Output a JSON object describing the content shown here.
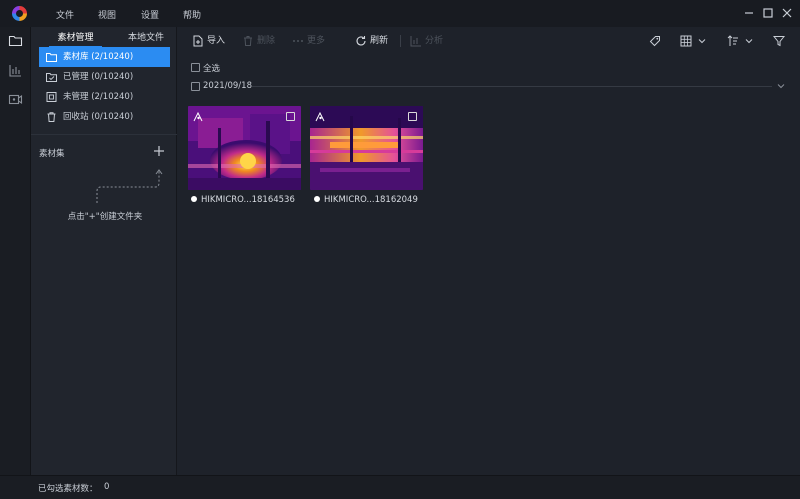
{
  "menu": {
    "items": [
      "文件",
      "视图",
      "设置",
      "帮助"
    ]
  },
  "activity": {
    "icons": [
      "folder-icon",
      "chart-icon",
      "video-icon"
    ]
  },
  "sidebar": {
    "tabs": [
      "素材管理",
      "本地文件"
    ],
    "libraries": [
      {
        "label": "素材库 (2/10240)",
        "icon": "folder-icon",
        "selected": true
      },
      {
        "label": "已管理 (0/10240)",
        "icon": "managed-folder-icon",
        "selected": false
      },
      {
        "label": "未管理 (2/10240)",
        "icon": "unmanaged-icon",
        "selected": false
      },
      {
        "label": "回收站 (0/10240)",
        "icon": "trash-icon",
        "selected": false
      }
    ],
    "sets_title": "素材集",
    "hint": "点击\"+\"创建文件夹"
  },
  "toolbar": {
    "import": "导入",
    "delete": "删除",
    "more": "更多",
    "refresh": "刷新",
    "analyze": "分析"
  },
  "content": {
    "select_all": "全选",
    "date_group": "2021/09/18",
    "items": [
      {
        "name": "HIKMICRO...18164536"
      },
      {
        "name": "HIKMICRO...18162049"
      }
    ]
  },
  "status": {
    "label": "已勾选素材数：",
    "count": "0"
  },
  "colors": {
    "accent": "#2b8cf2",
    "background": "#1e222a",
    "panel": "#21252d"
  }
}
